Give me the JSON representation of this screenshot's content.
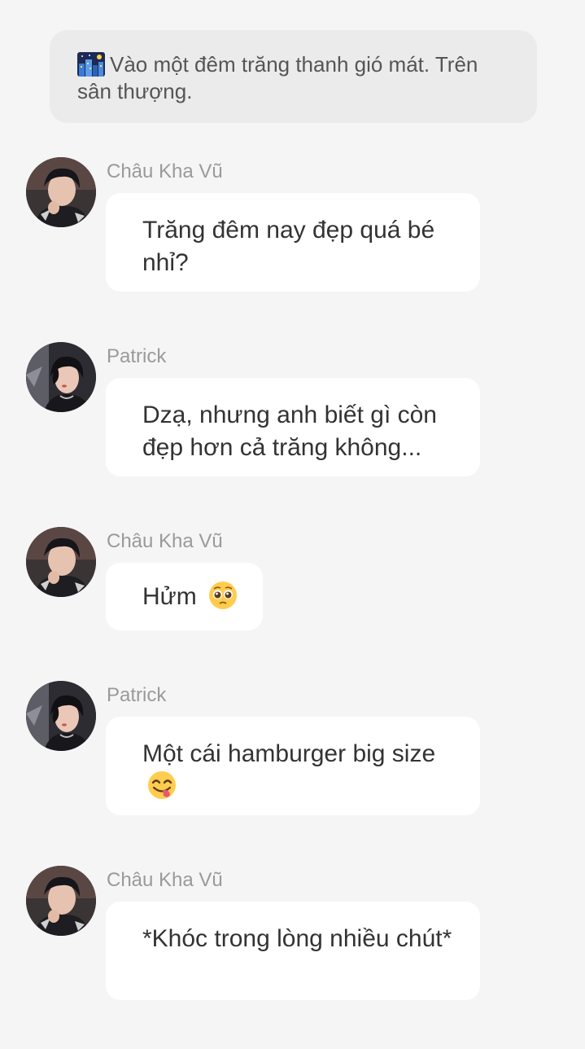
{
  "narration": {
    "icon": "night-city-emoji",
    "text": "Vào một đêm trăng thanh gió mát. Trên sân thượng."
  },
  "messages": [
    {
      "sender": "Châu Kha Vũ",
      "text": "Trăng đêm nay đẹp quá bé nhỉ?",
      "emoji": ""
    },
    {
      "sender": "Patrick",
      "text": "Dzạ, nhưng anh biết gì còn đẹp hơn cả trăng không...",
      "emoji": ""
    },
    {
      "sender": "Châu Kha Vũ",
      "text": "Hửm",
      "emoji": "pleading-face-emoji"
    },
    {
      "sender": "Patrick",
      "text": "Một cái hamburger big size",
      "emoji": "yum-face-emoji"
    },
    {
      "sender": "Châu Kha Vũ",
      "text": "*Khóc trong lòng nhiều chút*",
      "emoji": ""
    }
  ],
  "colors": {
    "background": "#f5f5f5",
    "narration_bg": "#ebebeb",
    "bubble_bg": "#ffffff",
    "sender_text": "#9a9a9a",
    "message_text": "#333333"
  }
}
